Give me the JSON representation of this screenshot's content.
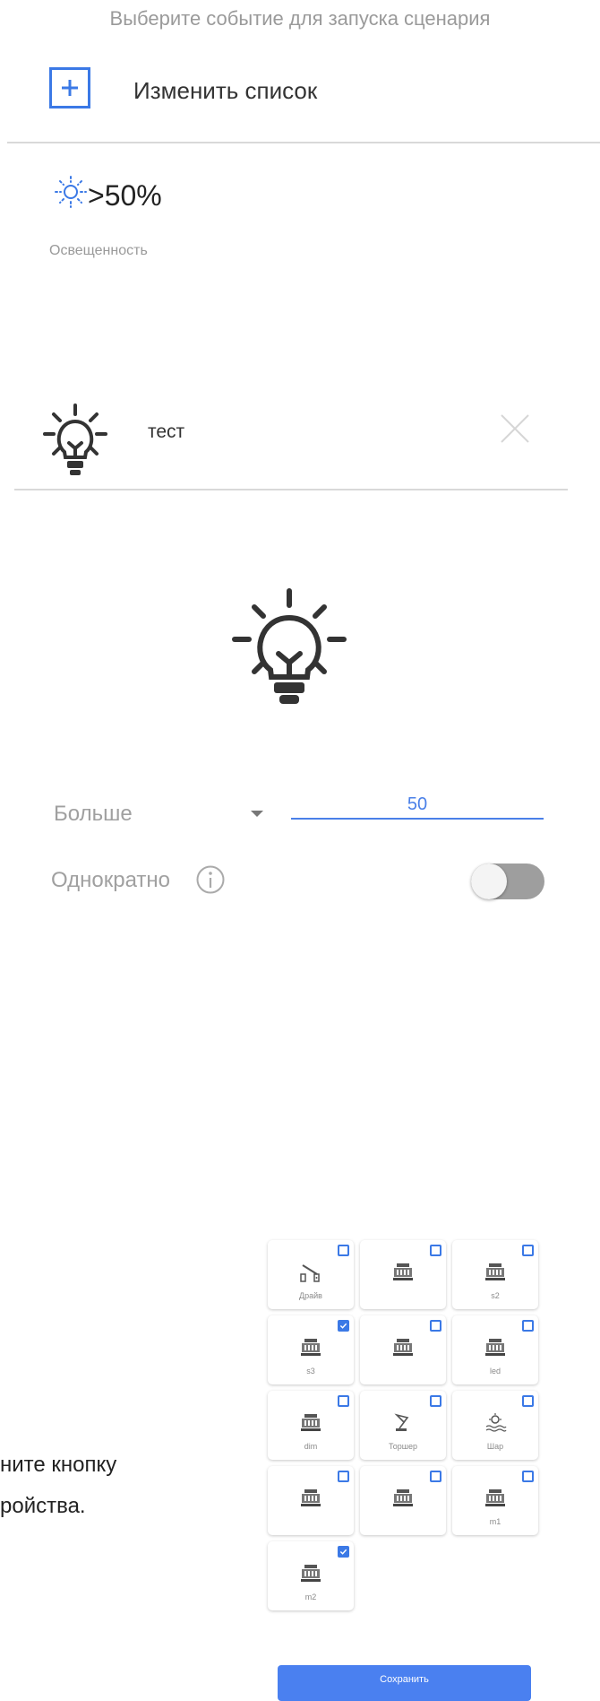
{
  "header": {
    "hint": "Выберите событие для запуска сценария",
    "change_list_label": "Изменить список"
  },
  "event": {
    "value": ">50%",
    "label": "Освещенность",
    "icon": "sun-icon"
  },
  "device": {
    "name": "тест",
    "icon": "lightbulb-icon"
  },
  "condition": {
    "operator": "Больше",
    "threshold": "50",
    "once_label": "Однократно",
    "once_enabled": false
  },
  "partial_hint": {
    "line1": "ните кнопку",
    "line2": "ройства."
  },
  "devices_grid": [
    {
      "label": "Драйв",
      "checked": false,
      "icon": "barrier-icon"
    },
    {
      "label": "",
      "checked": false,
      "icon": "device-icon"
    },
    {
      "label": "s2",
      "checked": false,
      "icon": "device-icon"
    },
    {
      "label": "s3",
      "checked": true,
      "icon": "device-icon"
    },
    {
      "label": "",
      "checked": false,
      "icon": "device-icon"
    },
    {
      "label": "led",
      "checked": false,
      "icon": "device-icon"
    },
    {
      "label": "dim",
      "checked": false,
      "icon": "device-icon"
    },
    {
      "label": "Торшер",
      "checked": false,
      "icon": "floor-lamp-icon"
    },
    {
      "label": "Шар",
      "checked": false,
      "icon": "ball-lamp-icon"
    },
    {
      "label": "",
      "checked": false,
      "icon": "device-icon"
    },
    {
      "label": "",
      "checked": false,
      "icon": "device-icon"
    },
    {
      "label": "m1",
      "checked": false,
      "icon": "device-icon"
    },
    {
      "label": "m2",
      "checked": true,
      "icon": "device-icon"
    }
  ],
  "save_label": "Сохранить",
  "colors": {
    "accent": "#3b79e6",
    "toggle_off": "#9e9e9e"
  }
}
